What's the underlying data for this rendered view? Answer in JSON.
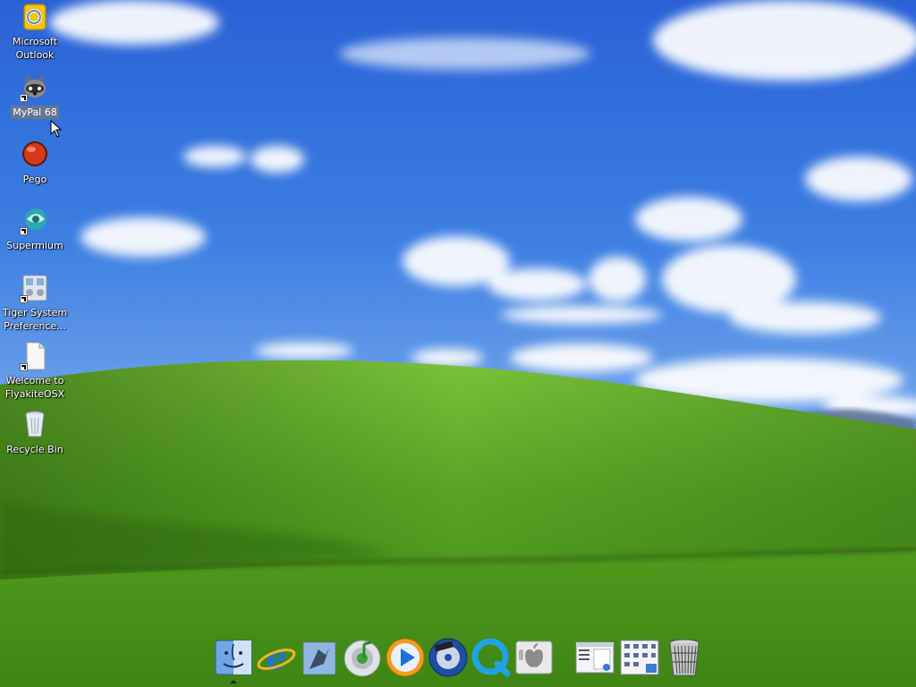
{
  "desktop": {
    "wallpaper": "bliss",
    "colors": {
      "sky_top": "#2a62d6",
      "sky_bottom": "#a9c9f0",
      "grass_light": "#6fb82e",
      "grass_dark": "#2f6f12"
    },
    "icons": [
      {
        "label": "Microsoft Outlook",
        "icon": "outlook-icon",
        "shortcut": false,
        "selected": false
      },
      {
        "label": "MyPal 68",
        "icon": "mypal-icon",
        "shortcut": true,
        "selected": true
      },
      {
        "label": "Pego",
        "icon": "pego-icon",
        "shortcut": false,
        "selected": false
      },
      {
        "label": "Supermium",
        "icon": "supermium-icon",
        "shortcut": true,
        "selected": false
      },
      {
        "label": "Tiger System Preference...",
        "icon": "system-preferences-icon",
        "shortcut": true,
        "selected": false
      },
      {
        "label": "Welcome to FlyakiteOSX",
        "icon": "document-icon",
        "shortcut": true,
        "selected": false
      },
      {
        "label": "Recycle Bin",
        "icon": "recycle-bin-icon",
        "shortcut": false,
        "selected": false
      }
    ]
  },
  "dock": {
    "items": [
      {
        "icon": "finder-icon",
        "running": true
      },
      {
        "icon": "internet-explorer-icon",
        "running": false
      },
      {
        "icon": "mail-icon",
        "running": false
      },
      {
        "icon": "itunes-icon",
        "running": false
      },
      {
        "icon": "media-player-icon",
        "running": false
      },
      {
        "icon": "dvd-player-icon",
        "running": false
      },
      {
        "icon": "quicktime-icon",
        "running": false
      },
      {
        "icon": "system-preferences-icon",
        "running": false
      },
      {
        "icon": "window-screenshot-icon",
        "running": false
      },
      {
        "icon": "control-panel-icon",
        "running": false
      },
      {
        "icon": "trash-icon",
        "running": false
      }
    ]
  }
}
